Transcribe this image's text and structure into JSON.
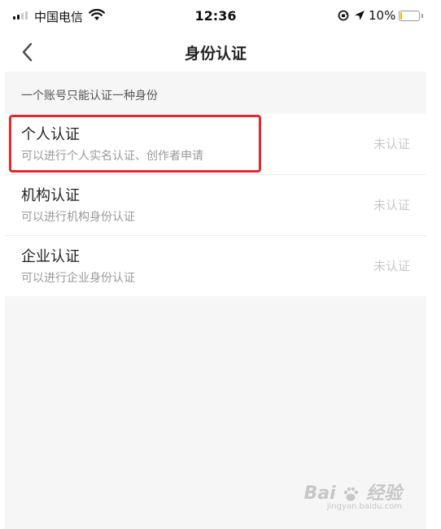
{
  "status_bar": {
    "carrier": "中国电信",
    "time": "12:36",
    "battery_percent": "10%",
    "battery_level": 0.1,
    "battery_color": "#f0b400"
  },
  "nav": {
    "title": "身份认证",
    "back_icon": "chevron-left-icon"
  },
  "notice": "一个账号只能认证一种身份",
  "items": [
    {
      "title": "个人认证",
      "desc": "可以进行个人实名认证、创作者申请",
      "status": "未认证",
      "highlighted": true
    },
    {
      "title": "机构认证",
      "desc": "可以进行机构身份认证",
      "status": "未认证"
    },
    {
      "title": "企业认证",
      "desc": "可以进行企业身份认证",
      "status": "未认证"
    }
  ],
  "highlight_color": "#e8262b",
  "watermark": {
    "brand": "Bai",
    "brand_cn": "经验",
    "url": "jingyan.baidu.com"
  }
}
